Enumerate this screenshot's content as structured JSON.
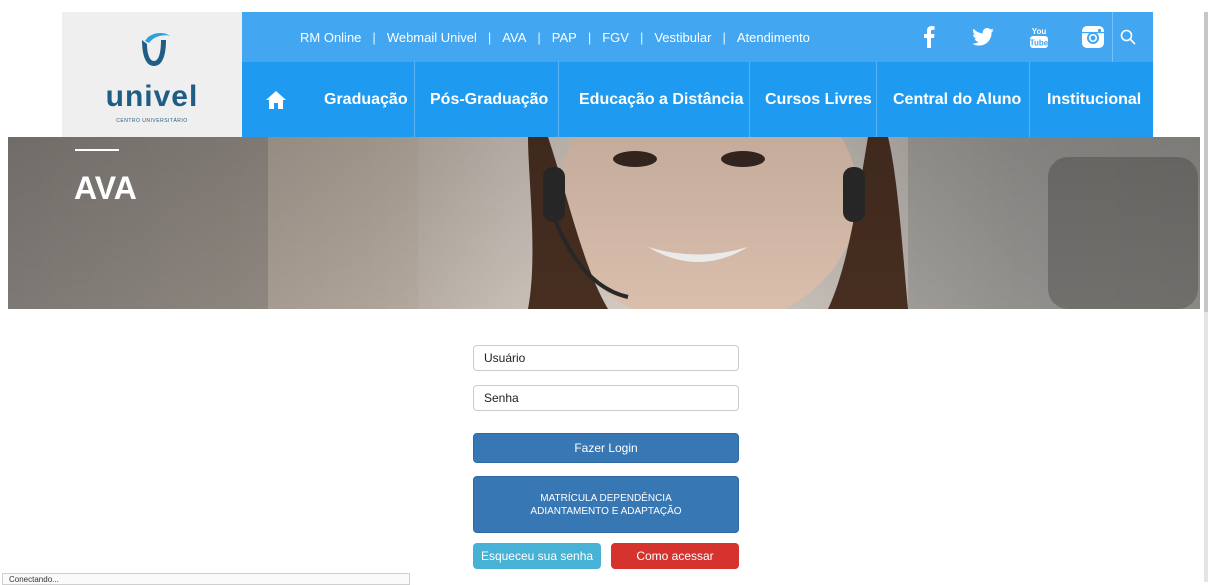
{
  "logo": {
    "name": "univel",
    "subtitle": "CENTRO UNIVERSITÁRIO"
  },
  "top_links": [
    "RM Online",
    "Webmail Univel",
    "AVA",
    "PAP",
    "FGV",
    "Vestibular",
    "Atendimento"
  ],
  "top_link_separator": "|",
  "social": [
    "facebook-icon",
    "twitter-icon",
    "youtube-icon",
    "instagram-icon",
    "search-icon"
  ],
  "nav": {
    "home_icon": "home-icon",
    "items": [
      "Graduação",
      "Pós-Graduação",
      "Educação a Distância",
      "Cursos Livres",
      "Central do Aluno",
      "Institucional"
    ]
  },
  "hero": {
    "title": "AVA"
  },
  "form": {
    "username_placeholder": "Usuário",
    "password_placeholder": "Senha",
    "login_label": "Fazer Login",
    "matricula_line1": "MATRÍCULA DEPENDÊNCIA",
    "matricula_line2": "ADIANTAMENTO E ADAPTAÇÃO",
    "forgot_label": "Esqueceu sua senha",
    "how_label": "Como acessar"
  },
  "status": {
    "text": "Conectando..."
  },
  "colors": {
    "topbar": "#42a6f1",
    "nav": "#1e9bf0",
    "logo_blue": "#1f5d84",
    "button_blue": "#3777b3",
    "button_cyan": "#47b2d6",
    "button_red": "#d6322e"
  }
}
